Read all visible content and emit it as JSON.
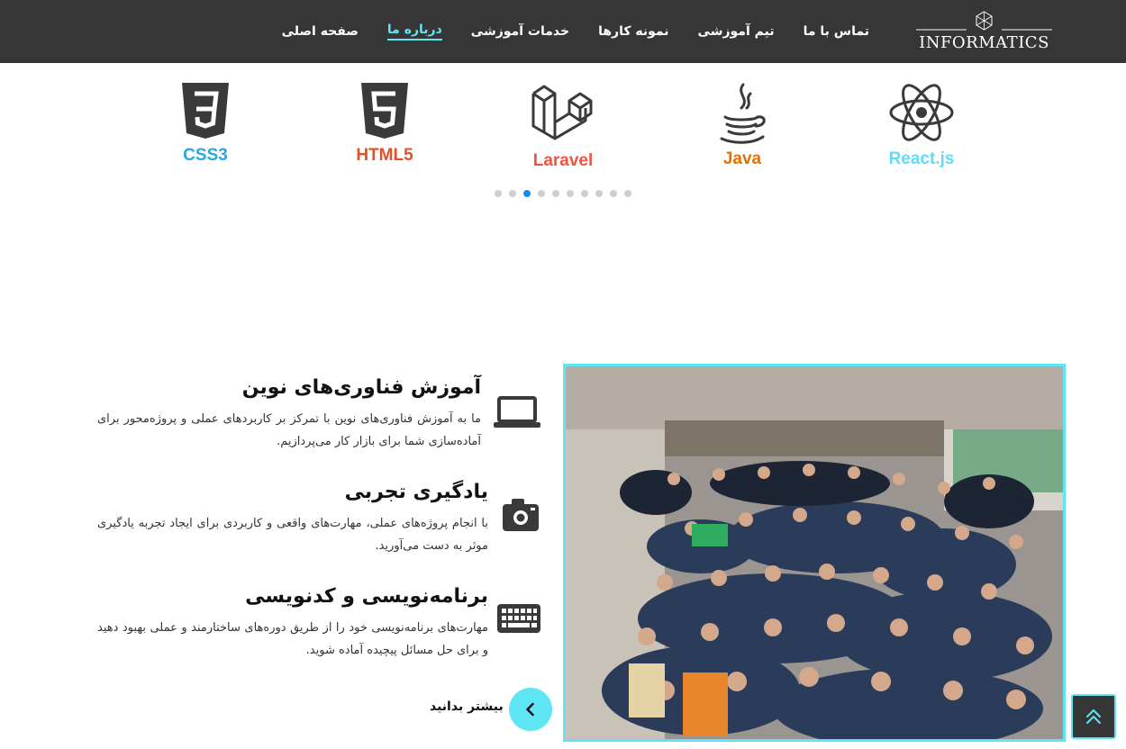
{
  "brand": {
    "name": "INFORMATICS",
    "accent": "#5ee6f5",
    "header_bg": "#363636"
  },
  "nav": {
    "items": [
      {
        "label": "صفحه اصلی",
        "active": false
      },
      {
        "label": "درباره ما",
        "active": true
      },
      {
        "label": "خدمات آموزشی",
        "active": false
      },
      {
        "label": "نمونه کارها",
        "active": false
      },
      {
        "label": "تیم آموزشی",
        "active": false
      },
      {
        "label": "تماس با ما",
        "active": false
      }
    ]
  },
  "carousel": {
    "items": [
      {
        "label": "React.js",
        "icon": "react-icon",
        "color": "#61dafb"
      },
      {
        "label": "Java",
        "icon": "java-icon",
        "color": "#e76f00"
      },
      {
        "label": "Laravel",
        "icon": "laravel-icon",
        "color": "#f05340"
      },
      {
        "label": "HTML5",
        "icon": "html5-icon",
        "color": "#e34f26"
      },
      {
        "label": "CSS3",
        "icon": "css3-icon",
        "color": "#29a8e0"
      }
    ],
    "dots_count": 10,
    "active_dot": 3
  },
  "features": [
    {
      "title": "آموزش فناوری‌های نوین",
      "text": "ما به آموزش فناوری‌های نوین با تمرکز بر کاربردهای عملی و پروژه‌محور برای آماده‌سازی شما برای بازار کار می‌پردازیم.",
      "icon": "laptop-icon"
    },
    {
      "title": "یادگیری تجربی",
      "text": "با انجام پروژه‌های عملی، مهارت‌های واقعی و کاربردی برای ایجاد تجربه یادگیری موثر به دست می‌آورید.",
      "icon": "camera-icon"
    },
    {
      "title": "برنامه‌نویسی و کدنویسی",
      "text": "مهارت‌های برنامه‌نویسی خود را از طریق دوره‌های ساختارمند و عملی بهبود دهید و برای حل مسائل پیچیده آماده شوید.",
      "icon": "keyboard-icon"
    }
  ],
  "more_label": "بیشتر بدانید",
  "photo": {
    "description_icon": "group-photo"
  },
  "scroll_top_icon": "double-chevron-up-icon"
}
